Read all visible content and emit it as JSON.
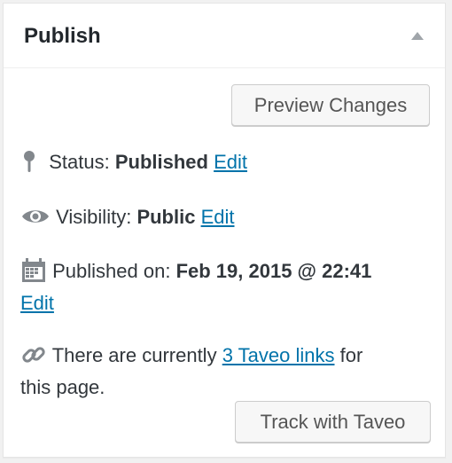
{
  "panel": {
    "title": "Publish",
    "toggle_icon": "triangle-up-icon"
  },
  "actions": {
    "preview_label": "Preview Changes",
    "track_label": "Track with Taveo"
  },
  "status": {
    "icon": "pin-icon",
    "label": "Status:",
    "value": "Published",
    "edit_label": "Edit"
  },
  "visibility": {
    "icon": "eye-icon",
    "label": "Visibility:",
    "value": "Public",
    "edit_label": "Edit"
  },
  "published_on": {
    "icon": "calendar-icon",
    "label": "Published on:",
    "value": "Feb 19, 2015 @ 22:41",
    "edit_label": "Edit"
  },
  "taveo": {
    "icon": "link-icon",
    "text_before": "There are currently",
    "link_label": "3 Taveo links",
    "text_after": "for",
    "text_line2": "this page."
  },
  "colors": {
    "link": "#0073aa",
    "text": "#32373c",
    "icon": "#82878c",
    "button_bg": "#f7f7f7",
    "button_border": "#cccccc"
  }
}
